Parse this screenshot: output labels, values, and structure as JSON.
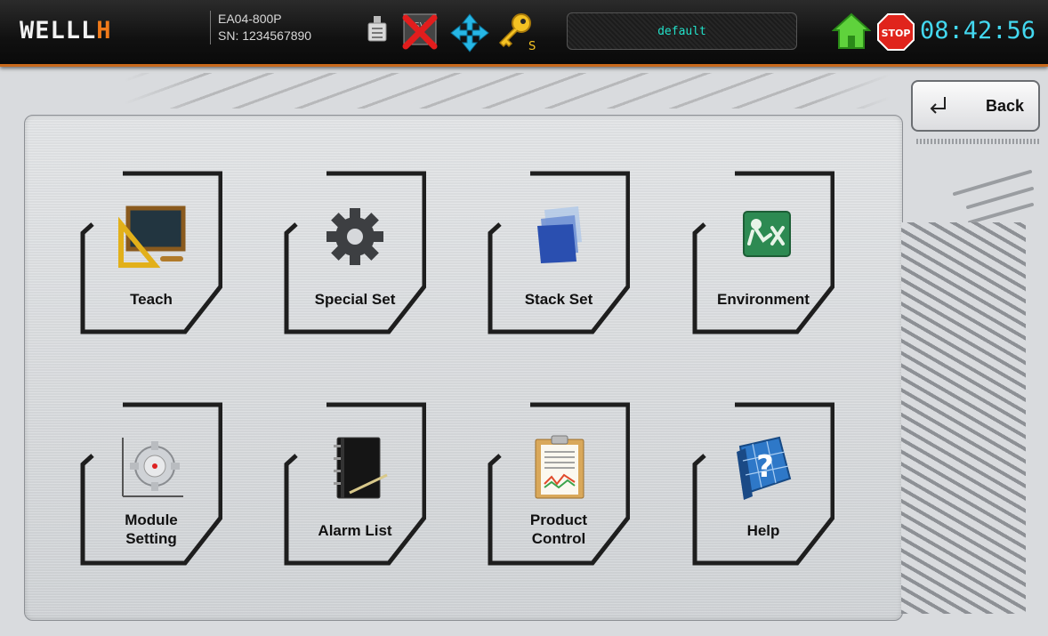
{
  "header": {
    "logo_main": "WELLL",
    "logo_accent": "H",
    "model": "EA04-800P",
    "serial": "SN: 1234567890",
    "profile": "default",
    "time": "08:42:56",
    "status_icons": [
      "usb-icon",
      "network-error-icon",
      "axis-move-icon",
      "key-icon"
    ]
  },
  "back_button": {
    "label": "Back"
  },
  "tiles": [
    {
      "label": "Teach",
      "icon": "chalkboard-icon"
    },
    {
      "label": "Special Set",
      "icon": "gear-icon"
    },
    {
      "label": "Stack Set",
      "icon": "stack-layers-icon"
    },
    {
      "label": "Environment",
      "icon": "environment-icon"
    },
    {
      "label": "Module Setting",
      "label1": "Module",
      "label2": "Setting",
      "icon": "module-gear-icon"
    },
    {
      "label": "Alarm List",
      "icon": "notebook-icon"
    },
    {
      "label": "Product Control",
      "label1": "Product",
      "label2": "Control",
      "icon": "clipboard-chart-icon"
    },
    {
      "label": "Help",
      "icon": "help-icon"
    }
  ],
  "colors": {
    "accent": "#c96a1d",
    "clock": "#43d8f0",
    "profile_text": "#22e0c8"
  }
}
